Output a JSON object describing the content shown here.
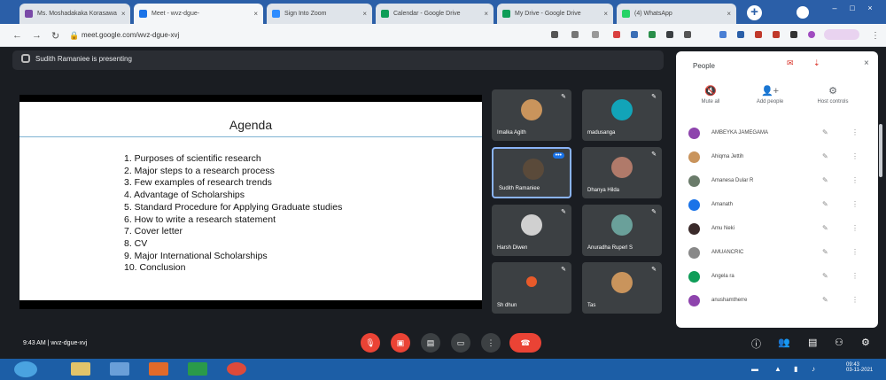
{
  "browser": {
    "tabs": [
      {
        "title": "Ms. Moshadakaka Korasawa",
        "active": false,
        "favicon_color": "#7a4aa8"
      },
      {
        "title": "Meet - wvz-dgue-",
        "active": true,
        "favicon_color": "#1a73e8"
      },
      {
        "title": "Sign Into Zoom",
        "active": false,
        "favicon_color": "#2d8cff"
      },
      {
        "title": "Calendar - Google Drive",
        "active": false,
        "favicon_color": "#0f9d58"
      },
      {
        "title": "My Drive - Google Drive",
        "active": false,
        "favicon_color": "#0f9d58"
      },
      {
        "title": "(4) WhatsApp",
        "active": false,
        "favicon_color": "#25d366"
      }
    ],
    "new_tab_label": "+",
    "url": "meet.google.com/wvz-dgue-xvj",
    "window_controls": [
      "–",
      "□",
      "×"
    ]
  },
  "meet": {
    "presenter_bar_text": "Sudith Ramaniee is presenting",
    "slide": {
      "title": "Agenda",
      "items": [
        "1.   Purposes of scientific research",
        "2.   Major steps to a research process",
        "3.   Few examples of research trends",
        "4.   Advantage of Scholarships",
        "5.   Standard Procedure for Applying Graduate studies",
        "6.   How to write a research statement",
        "7.   Cover letter",
        "8.   CV",
        "9.   Major International Scholarships",
        "10. Conclusion"
      ]
    },
    "tiles": [
      {
        "name": "Imalka Agith",
        "avatar_color": "#c9945c"
      },
      {
        "name": "madusanga",
        "avatar_color": "#12a4b8"
      },
      {
        "name": "Sudith Ramaniee",
        "avatar_color": "#5a4a3a",
        "highlighted": true
      },
      {
        "name": "Dhanya Hilda",
        "avatar_color": "#b07a6a"
      },
      {
        "name": "Harsh Diwen",
        "avatar_color": "#d0d0d0"
      },
      {
        "name": "Anuradha Ruperl S",
        "avatar_color": "#6aa09a"
      },
      {
        "name": "Sh dhun",
        "avatar_color": "#e85a2a"
      },
      {
        "name": "Tas",
        "avatar_color": "#c9945c"
      }
    ],
    "clock_text": "9:43 AM  |  wvz-dgue-xvj",
    "controls": [
      {
        "name": "mic-button",
        "symbol": "🎙",
        "style": "red"
      },
      {
        "name": "camera-button",
        "symbol": "▣",
        "style": "red"
      },
      {
        "name": "captions-button",
        "symbol": "▤",
        "style": "gray"
      },
      {
        "name": "present-button",
        "symbol": "▭",
        "style": "gray"
      },
      {
        "name": "more-options-button",
        "symbol": "⋮",
        "style": "gray"
      },
      {
        "name": "leave-call-button",
        "symbol": "☎",
        "style": "red"
      }
    ],
    "right_controls": [
      "ⓘ",
      "👥",
      "▤",
      "⚇",
      "⚙"
    ]
  },
  "people_panel": {
    "title": "People",
    "close_label": "×",
    "actions": [
      {
        "label": "Mute all",
        "icon": "🔇"
      },
      {
        "label": "Add people",
        "icon": "👤+"
      },
      {
        "label": "Host controls",
        "icon": "⚙"
      }
    ],
    "people": [
      {
        "name": "AMBEYKA JAMEGAMA",
        "avatar_color": "#8e44ad"
      },
      {
        "name": "Ahiqma Jettih",
        "avatar_color": "#c9945c"
      },
      {
        "name": "Amanesa Dular R",
        "avatar_color": "#6a7b6a"
      },
      {
        "name": "Amanath",
        "avatar_color": "#1a73e8"
      },
      {
        "name": "Amu Neki",
        "avatar_color": "#3a2a2a"
      },
      {
        "name": "AMUANCRIC",
        "avatar_color": "#888"
      },
      {
        "name": "Angela ra",
        "avatar_color": "#0f9d58"
      },
      {
        "name": "anushamtherre",
        "avatar_color": "#8e44ad"
      }
    ]
  },
  "taskbar": {
    "time": "09:43",
    "date": "03-11-2021"
  },
  "colors": {
    "meet_background": "#1a1d22",
    "tile_background": "#3c4043",
    "accent_red": "#ea4335",
    "tab_bar": "#2b5fa8",
    "taskbar": "#1c5ea6"
  }
}
